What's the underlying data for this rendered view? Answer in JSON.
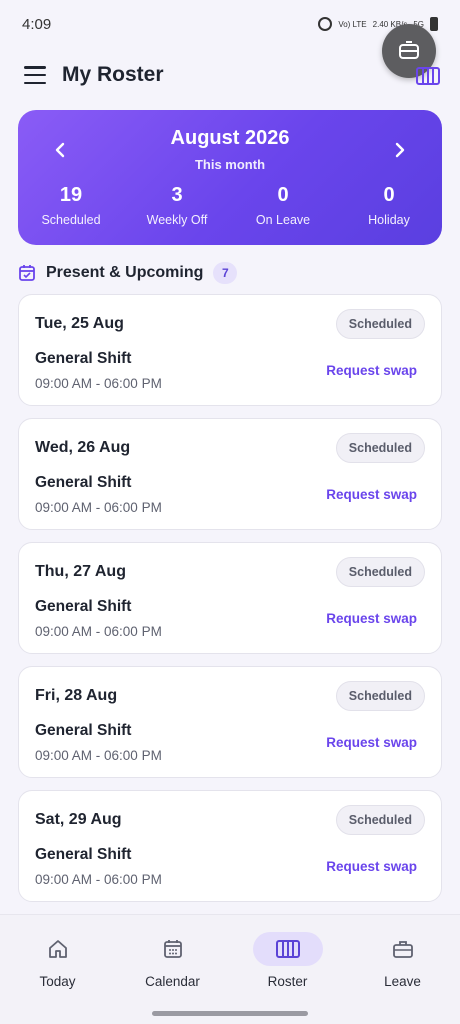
{
  "status_bar": {
    "time": "4:09",
    "network_text": "Vo) LTE",
    "speed_text": "2.40 KB/s",
    "signal_text": "5G"
  },
  "header": {
    "title": "My Roster"
  },
  "month_card": {
    "title": "August 2026",
    "subtitle": "This month",
    "stats": [
      {
        "value": "19",
        "label": "Scheduled"
      },
      {
        "value": "3",
        "label": "Weekly Off"
      },
      {
        "value": "0",
        "label": "On Leave"
      },
      {
        "value": "0",
        "label": "Holiday"
      }
    ]
  },
  "section": {
    "title": "Present & Upcoming",
    "count": "7"
  },
  "shifts": [
    {
      "date": "Tue, 25 Aug",
      "status": "Scheduled",
      "shift": "General Shift",
      "time": "09:00 AM - 06:00 PM",
      "action": "Request swap"
    },
    {
      "date": "Wed, 26 Aug",
      "status": "Scheduled",
      "shift": "General Shift",
      "time": "09:00 AM - 06:00 PM",
      "action": "Request swap"
    },
    {
      "date": "Thu, 27 Aug",
      "status": "Scheduled",
      "shift": "General Shift",
      "time": "09:00 AM - 06:00 PM",
      "action": "Request swap"
    },
    {
      "date": "Fri, 28 Aug",
      "status": "Scheduled",
      "shift": "General Shift",
      "time": "09:00 AM - 06:00 PM",
      "action": "Request swap"
    },
    {
      "date": "Sat, 29 Aug",
      "status": "Scheduled",
      "shift": "General Shift",
      "time": "09:00 AM - 06:00 PM",
      "action": "Request swap"
    }
  ],
  "bottom_nav": [
    {
      "label": "Today",
      "icon": "home-icon",
      "active": false
    },
    {
      "label": "Calendar",
      "icon": "calendar-icon",
      "active": false
    },
    {
      "label": "Roster",
      "icon": "roster-icon",
      "active": true
    },
    {
      "label": "Leave",
      "icon": "briefcase-icon",
      "active": false
    }
  ],
  "colors": {
    "accent": "#6a45ec",
    "gradient_start": "#8a5cf6",
    "gradient_end": "#5a3fe0",
    "badge_bg": "#e6e1fb"
  }
}
